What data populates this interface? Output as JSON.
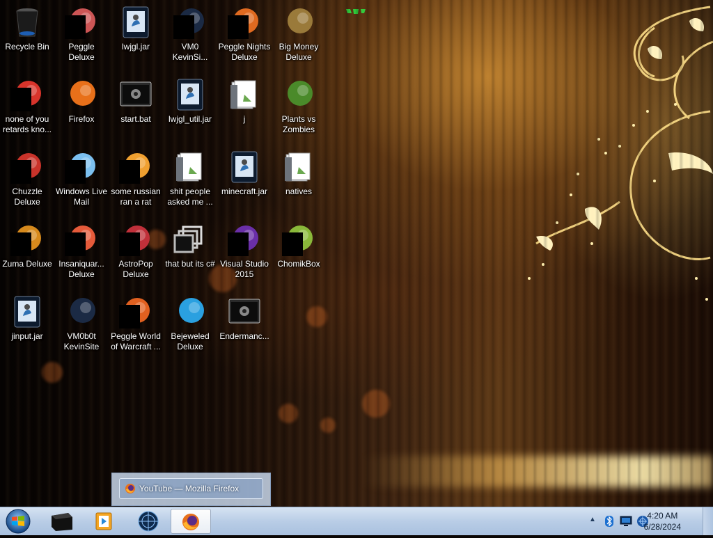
{
  "desktop": {
    "icons": [
      {
        "label": "Recycle Bin",
        "icon": "recycle-bin-icon"
      },
      {
        "label": "none of you retards kno...",
        "icon": "firefox-shortcut-icon"
      },
      {
        "label": "Chuzzle Deluxe",
        "icon": "chuzzle-icon"
      },
      {
        "label": "Zuma Deluxe",
        "icon": "zuma-icon"
      },
      {
        "label": "jinput.jar",
        "icon": "jar-file-icon"
      },
      {
        "label": "Peggle Deluxe",
        "icon": "peggle-icon"
      },
      {
        "label": "Firefox",
        "icon": "firefox-icon"
      },
      {
        "label": "Windows Live Mail",
        "icon": "windows-live-mail-icon"
      },
      {
        "label": "Insaniquar... Deluxe",
        "icon": "insaniquarium-icon"
      },
      {
        "label": "VM0b0t KevinSite",
        "icon": "shortcut-icon"
      },
      {
        "label": "lwjgl.jar",
        "icon": "jar-file-icon"
      },
      {
        "label": "start.bat",
        "icon": "batch-file-icon"
      },
      {
        "label": "some russian ran a rat",
        "icon": "ie-icon"
      },
      {
        "label": "AstroPop Deluxe",
        "icon": "astropop-icon"
      },
      {
        "label": "Peggle World of Warcraft ...",
        "icon": "peggle-wow-icon"
      },
      {
        "label": "VM0 KevinSi...",
        "icon": "shortcut-icon"
      },
      {
        "label": "lwjgl_util.jar",
        "icon": "jar-file-icon"
      },
      {
        "label": "shit people asked me ...",
        "icon": "folder-icon"
      },
      {
        "label": "that but its c#",
        "icon": "stacked-windows-icon"
      },
      {
        "label": "Bejeweled Deluxe",
        "icon": "bejeweled-icon"
      },
      {
        "label": "Peggle Nights Deluxe",
        "icon": "peggle-nights-icon"
      },
      {
        "label": "j",
        "icon": "folder-icon"
      },
      {
        "label": "minecraft.jar",
        "icon": "jar-file-icon"
      },
      {
        "label": "Visual Studio 2015",
        "icon": "visual-studio-icon"
      },
      {
        "label": "Endermanc...",
        "icon": "console-app-icon"
      },
      {
        "label": "Big Money Deluxe",
        "icon": "big-money-icon"
      },
      {
        "label": "Plants vs Zombies",
        "icon": "plants-vs-zombies-icon"
      },
      {
        "label": "natives",
        "icon": "folder-icon"
      },
      {
        "label": "ChomikBox",
        "icon": "chomikbox-icon"
      }
    ]
  },
  "taskbar": {
    "start_icon": "windows-orb-icon",
    "pinned": [
      {
        "icon": "black-box-app-icon"
      },
      {
        "icon": "media-player-icon"
      },
      {
        "icon": "globe-app-icon"
      },
      {
        "icon": "firefox-icon",
        "active": true
      }
    ],
    "preview_title": "YouTube — Mozilla Firefox",
    "tray_icons": [
      "show-hidden-icons-chevron",
      "bluetooth-icon",
      "monitor-icon",
      "network-icon"
    ],
    "clock_time": "4:20 AM",
    "clock_date": "6/28/2024"
  },
  "colors": {
    "label_text": "#ffffff",
    "taskbar_top": "#d6e3f2",
    "taskbar_bottom": "#a9c1df",
    "wallpaper_gold": "#ffd670"
  }
}
